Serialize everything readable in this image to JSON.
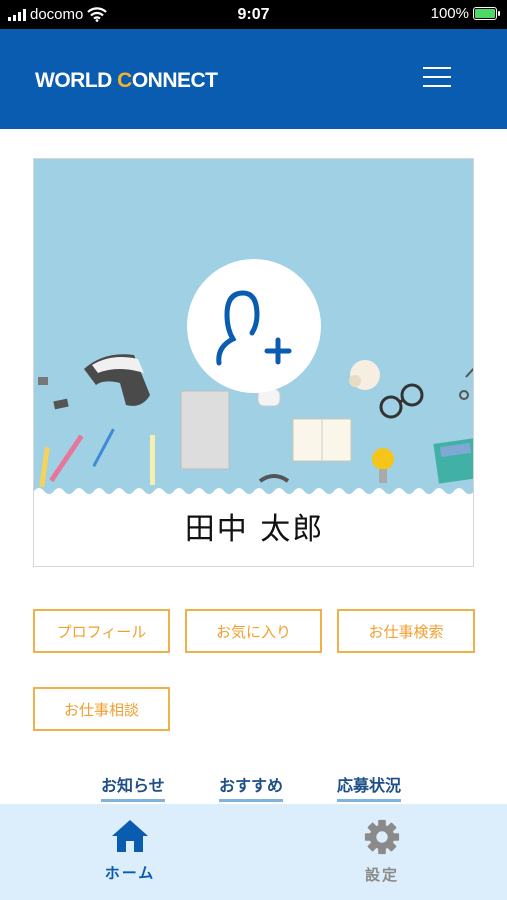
{
  "status_bar": {
    "carrier": "docomo",
    "time": "9:07",
    "battery": "100%"
  },
  "header": {
    "logo": {
      "part1": "WORLD ",
      "accent": "C",
      "part2": "ONNECT"
    },
    "menu_icon": "hamburger-menu-icon"
  },
  "profile": {
    "name": "田中 太郎",
    "add_icon": "user-plus-icon"
  },
  "actions": [
    "プロフィール",
    "お気に入り",
    "お仕事検索",
    "お仕事相談"
  ],
  "links": [
    "お知らせ",
    "おすすめ",
    "応募状況"
  ],
  "tab_bar": [
    {
      "label": "ホーム",
      "icon": "home-icon",
      "active": true
    },
    {
      "label": "設定",
      "icon": "gear-icon",
      "active": false
    }
  ],
  "colors": {
    "brand_blue": "#0a5cb1",
    "accent_orange": "#f0b04a",
    "tab_bg": "#dceefb"
  }
}
